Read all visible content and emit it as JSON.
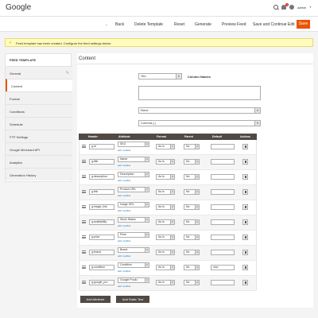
{
  "app": {
    "title": "Google"
  },
  "header": {
    "notifications": "1",
    "user": "admin"
  },
  "toolbar": {
    "back": "Back",
    "delete": "Delete Template",
    "reset": "Reset",
    "generate": "Generate",
    "preview": "Preview Feed",
    "save_continue": "Save and Continue Edit",
    "save": "Save"
  },
  "message": "Feed template has been created. Configure the feed settings below.",
  "sidebar": {
    "title": "FEED TEMPLATE",
    "items": [
      {
        "label": "General",
        "state": "inactive",
        "edit": true
      },
      {
        "label": "Content",
        "state": "active",
        "edit": false
      },
      {
        "label": "Format",
        "state": "inactive",
        "edit": false
      },
      {
        "label": "Conditions",
        "state": "inactive",
        "edit": false
      },
      {
        "label": "Schedule",
        "state": "inactive",
        "edit": false
      },
      {
        "label": "FTP Settings",
        "state": "inactive",
        "edit": false
      },
      {
        "label": "Google Merchant API",
        "state": "inactive",
        "edit": false
      },
      {
        "label": "Analytics",
        "state": "inactive",
        "edit": false
      },
      {
        "label": "Generation History",
        "state": "inactive",
        "edit": false
      }
    ]
  },
  "content": {
    "title": "Content",
    "column_names_label": "Column Names",
    "column_names_value": "Yes",
    "header_label": "Header",
    "enclosed_label": "Fields enclosed by",
    "enclosed_value": "None",
    "separated_label": "Fields separated by",
    "separated_value": "Comma (,)"
  },
  "table": {
    "columns": [
      "Header",
      "Attribute",
      "Format",
      "Parent",
      "Default",
      "Actions"
    ],
    "add_modifier": "add modifier",
    "rows": [
      {
        "header": "g:id",
        "attribute": "SKU",
        "format": "As Is",
        "parent": "No",
        "default": ""
      },
      {
        "header": "g:title",
        "attribute": "Name",
        "format": "As Is",
        "parent": "No",
        "default": ""
      },
      {
        "header": "g:description",
        "attribute": "Description",
        "format": "As Is",
        "parent": "No",
        "default": ""
      },
      {
        "header": "g:link",
        "attribute": "Product URL",
        "format": "As Is",
        "parent": "No",
        "default": ""
      },
      {
        "header": "g:image_link",
        "attribute": "Image URL",
        "format": "As Is",
        "parent": "No",
        "default": ""
      },
      {
        "header": "g:availability",
        "attribute": "Stock Status",
        "format": "As Is",
        "parent": "No",
        "default": ""
      },
      {
        "header": "g:price",
        "attribute": "Price",
        "format": "As Is",
        "parent": "No",
        "default": ""
      },
      {
        "header": "g:brand",
        "attribute": "Brand",
        "format": "As Is",
        "parent": "No",
        "default": ""
      },
      {
        "header": "g:condition",
        "attribute": "Condition",
        "format": "As Is",
        "parent": "No",
        "default": "new"
      },
      {
        "header": "g:google_pro",
        "attribute": "Google Produ",
        "format": "As Is",
        "parent": "No",
        "default": ""
      }
    ]
  },
  "buttons": {
    "add_attribute": "Add Attribute",
    "add_static": "Add Static Text"
  },
  "colors": {
    "accent": "#eb5202",
    "table_header": "#514943",
    "notice_bg": "#fffbbb"
  }
}
